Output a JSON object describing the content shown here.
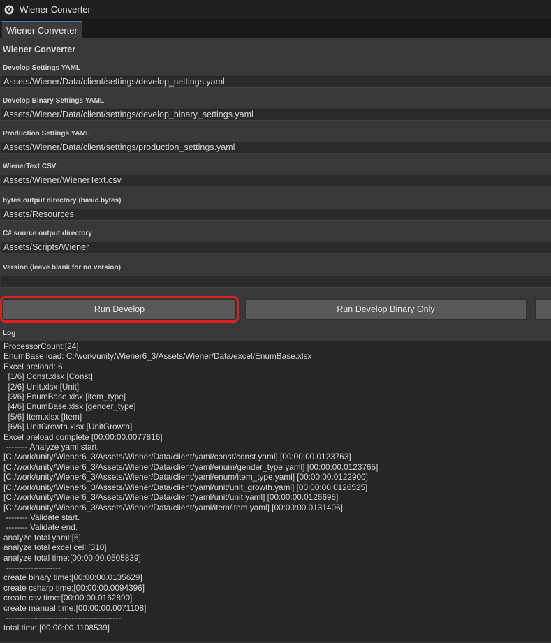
{
  "window": {
    "title": "Wiener Converter",
    "icon": "unity-icon"
  },
  "tab": {
    "label": "Wiener Converter"
  },
  "panel": {
    "header": "Wiener Converter",
    "fields": [
      {
        "label": "Develop Settings YAML",
        "value": "Assets/Wiener/Data/client/settings/develop_settings.yaml"
      },
      {
        "label": "Develop Binary Settings YAML",
        "value": "Assets/Wiener/Data/client/settings/develop_binary_settings.yaml"
      },
      {
        "label": "Production Settings YAML",
        "value": "Assets/Wiener/Data/client/settings/production_settings.yaml"
      },
      {
        "label": "WienerText CSV",
        "value": "Assets/Wiener/WienerText.csv"
      },
      {
        "label": "bytes output directory (basic.bytes)",
        "value": "Assets/Resources"
      },
      {
        "label": "C# source output directory",
        "value": "Assets/Scripts/Wiener"
      },
      {
        "label": "Version (leave blank for no version)",
        "value": ""
      }
    ],
    "buttons": {
      "run_develop": "Run Develop",
      "run_develop_binary_only": "Run Develop Binary Only",
      "third": ""
    },
    "log_label": "Log",
    "log_lines": [
      "ProcessorCount:[24]",
      "EnumBase load: C:/work/unity/Wiener6_3/Assets/Wiener/Data/excel/EnumBase.xlsx",
      "Excel preload: 6",
      "  [1/6] Const.xlsx [Const]",
      "  [2/6] Unit.xlsx [Unit]",
      "  [3/6] EnumBase.xlsx [item_type]",
      "  [4/6] EnumBase.xlsx [gender_type]",
      "  [5/6] Item.xlsx [Item]",
      "  [6/6] UnitGrowth.xlsx [UnitGrowth]",
      "Excel preload complete [00:00:00.0077816]",
      " -------- Analyze yaml start.",
      "[C:/work/unity/Wiener6_3/Assets/Wiener/Data/client/yaml/const/const.yaml] [00:00:00.0123763]",
      "[C:/work/unity/Wiener6_3/Assets/Wiener/Data/client/yaml/enum/gender_type.yaml] [00:00:00.0123765]",
      "[C:/work/unity/Wiener6_3/Assets/Wiener/Data/client/yaml/enum/item_type.yaml] [00:00:00.0122900]",
      "[C:/work/unity/Wiener6_3/Assets/Wiener/Data/client/yaml/unit/unit_growth.yaml] [00:00:00.0126525]",
      "[C:/work/unity/Wiener6_3/Assets/Wiener/Data/client/yaml/unit/unit.yaml] [00:00:00.0126695]",
      "[C:/work/unity/Wiener6_3/Assets/Wiener/Data/client/yaml/item/item.yaml] [00:00:00.0131406]",
      " -------- Validate start.",
      " -------- Validate end.",
      "analyze total yaml:[6]",
      "analyze total excel cell:[310]",
      "analyze total time:[00:00:00.0505839]",
      " --------------------",
      "create binary time:[00:00:00.0135629]",
      "create csharp time:[00:00:00.0094396]",
      "create csv time:[00:00:00.0162890]",
      "create manual time:[00:00:00.0071108]",
      " ------------------------------------------",
      "total time:[00:00:00.1108539]"
    ]
  },
  "colors": {
    "highlight": "#e01f1f",
    "tab_accent": "#3a79bb"
  }
}
